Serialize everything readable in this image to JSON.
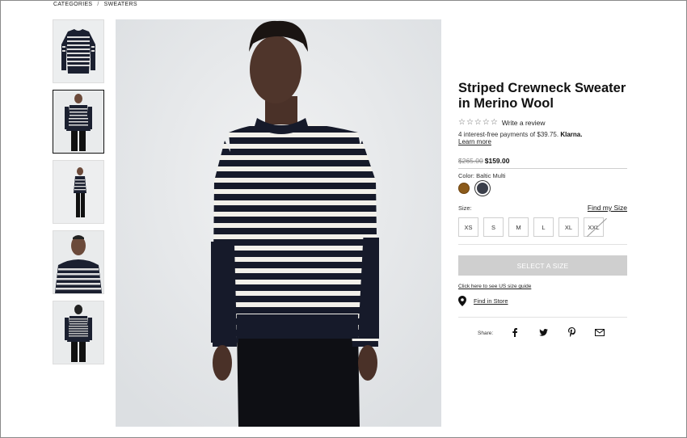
{
  "breadcrumb": {
    "items": [
      "CATEGORIES",
      "SWEATERS"
    ],
    "separator": "/"
  },
  "thumbnails": [
    {
      "name": "flat-lay",
      "active": false
    },
    {
      "name": "front",
      "active": true
    },
    {
      "name": "side-lean",
      "active": false
    },
    {
      "name": "detail",
      "active": false
    },
    {
      "name": "back",
      "active": false
    }
  ],
  "product": {
    "title": "Striped Crewneck Sweater in Merino Wool",
    "stars": "☆☆☆☆☆",
    "review_link": "Write a review",
    "installments_text": "4 interest-free payments of $39.75.",
    "klarna": "Klarna.",
    "learn_more": "Learn more",
    "old_price": "$265.00",
    "new_price": "$159.00",
    "color_label": "Color:",
    "color_value": "Baltic Multi",
    "colors": [
      {
        "name": "brown",
        "hex": "#8b5a1a"
      },
      {
        "name": "baltic-multi",
        "hex": "#3b3f4a"
      }
    ],
    "size_label": "Size:",
    "find_size": "Find my Size",
    "sizes": [
      "XS",
      "S",
      "M",
      "L",
      "XL",
      "XXL"
    ],
    "select_button": "SELECT A SIZE",
    "size_guide": "Click here to see US size guide",
    "find_store": "Find in Store",
    "share_label": "Share:"
  },
  "share_icons": [
    "facebook-icon",
    "twitter-icon",
    "pinterest-icon",
    "email-icon"
  ]
}
